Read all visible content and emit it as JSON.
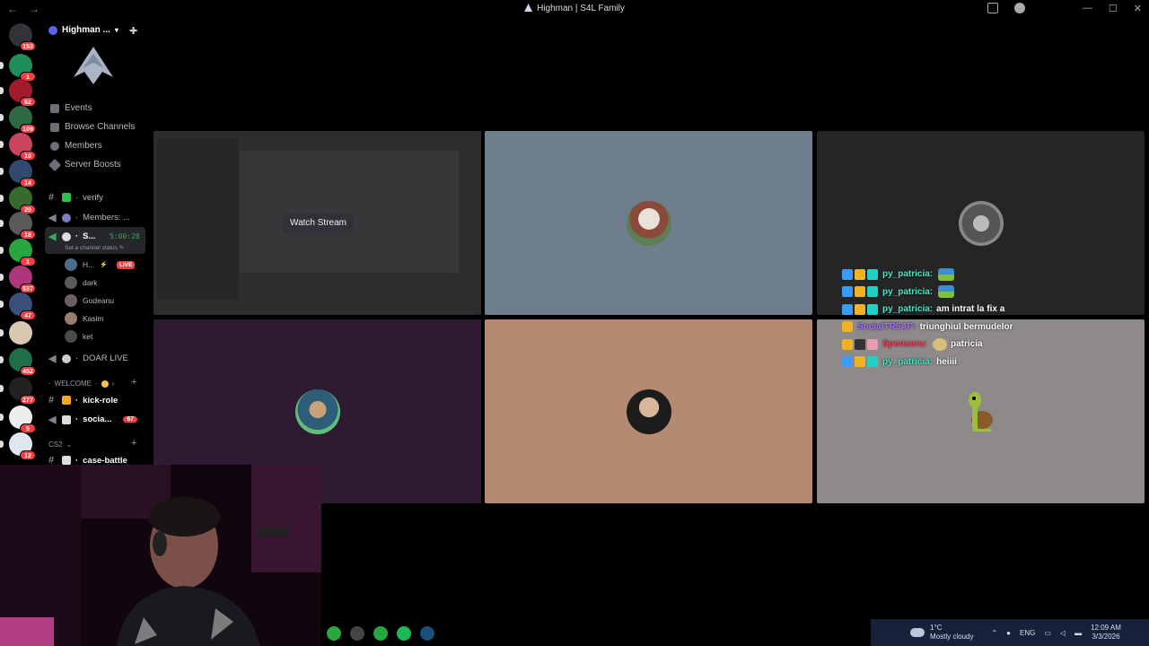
{
  "window": {
    "title": "Highman | S4L Family"
  },
  "rail": {
    "badges": [
      "153",
      "1",
      "62",
      "109",
      "10",
      "14",
      "20",
      "18",
      "1",
      "537",
      "47",
      "",
      "452",
      "277",
      "5",
      "12"
    ]
  },
  "sidebar": {
    "server_name": "Highman ...",
    "menu": [
      {
        "label": "Events"
      },
      {
        "label": "Browse Channels"
      },
      {
        "label": "Members"
      },
      {
        "label": "Server Boosts"
      }
    ],
    "channels": {
      "verify": "verify",
      "members": "Members: ...",
      "active_voice": "S...",
      "timer": "5:00:28",
      "status_placeholder": "Set a channel status",
      "doar_live": "DOAR LIVE",
      "welcome_category": "WELCOME",
      "kick_role": "kick-role",
      "social": "socia...",
      "social_badge": "67",
      "cs2_category": "CS2",
      "case_battle": "case-battle"
    },
    "voice_users": [
      {
        "name": "H...",
        "live": "LIVE"
      },
      {
        "name": "dark"
      },
      {
        "name": "Godeanu"
      },
      {
        "name": "Kasim"
      },
      {
        "name": "ket"
      }
    ]
  },
  "stage": {
    "watch_stream_label": "Watch Stream"
  },
  "chat": {
    "messages": [
      {
        "user": "py_patricia:",
        "text": "",
        "user_color": "#43e8c4"
      },
      {
        "user": "py_patricia:",
        "text": "",
        "user_color": "#43e8c4"
      },
      {
        "user": "py_patricia:",
        "text": "am intrat la fix a",
        "user_color": "#43e8c4"
      },
      {
        "user": "SocialTR5AP:",
        "text": "triunghiul bermudelor",
        "user_color": "#a970ff"
      },
      {
        "user": "Sponsoru:",
        "text": "patricia",
        "user_color": "#ff3b5c"
      },
      {
        "user": "py_patricia:",
        "text": "heiiii",
        "user_color": "#43e8c4"
      }
    ]
  },
  "taskbar": {
    "temperature": "1°C",
    "weather": "Mostly cloudy",
    "language": "ENG",
    "time": "12:09 AM",
    "date": "3/3/2026"
  }
}
